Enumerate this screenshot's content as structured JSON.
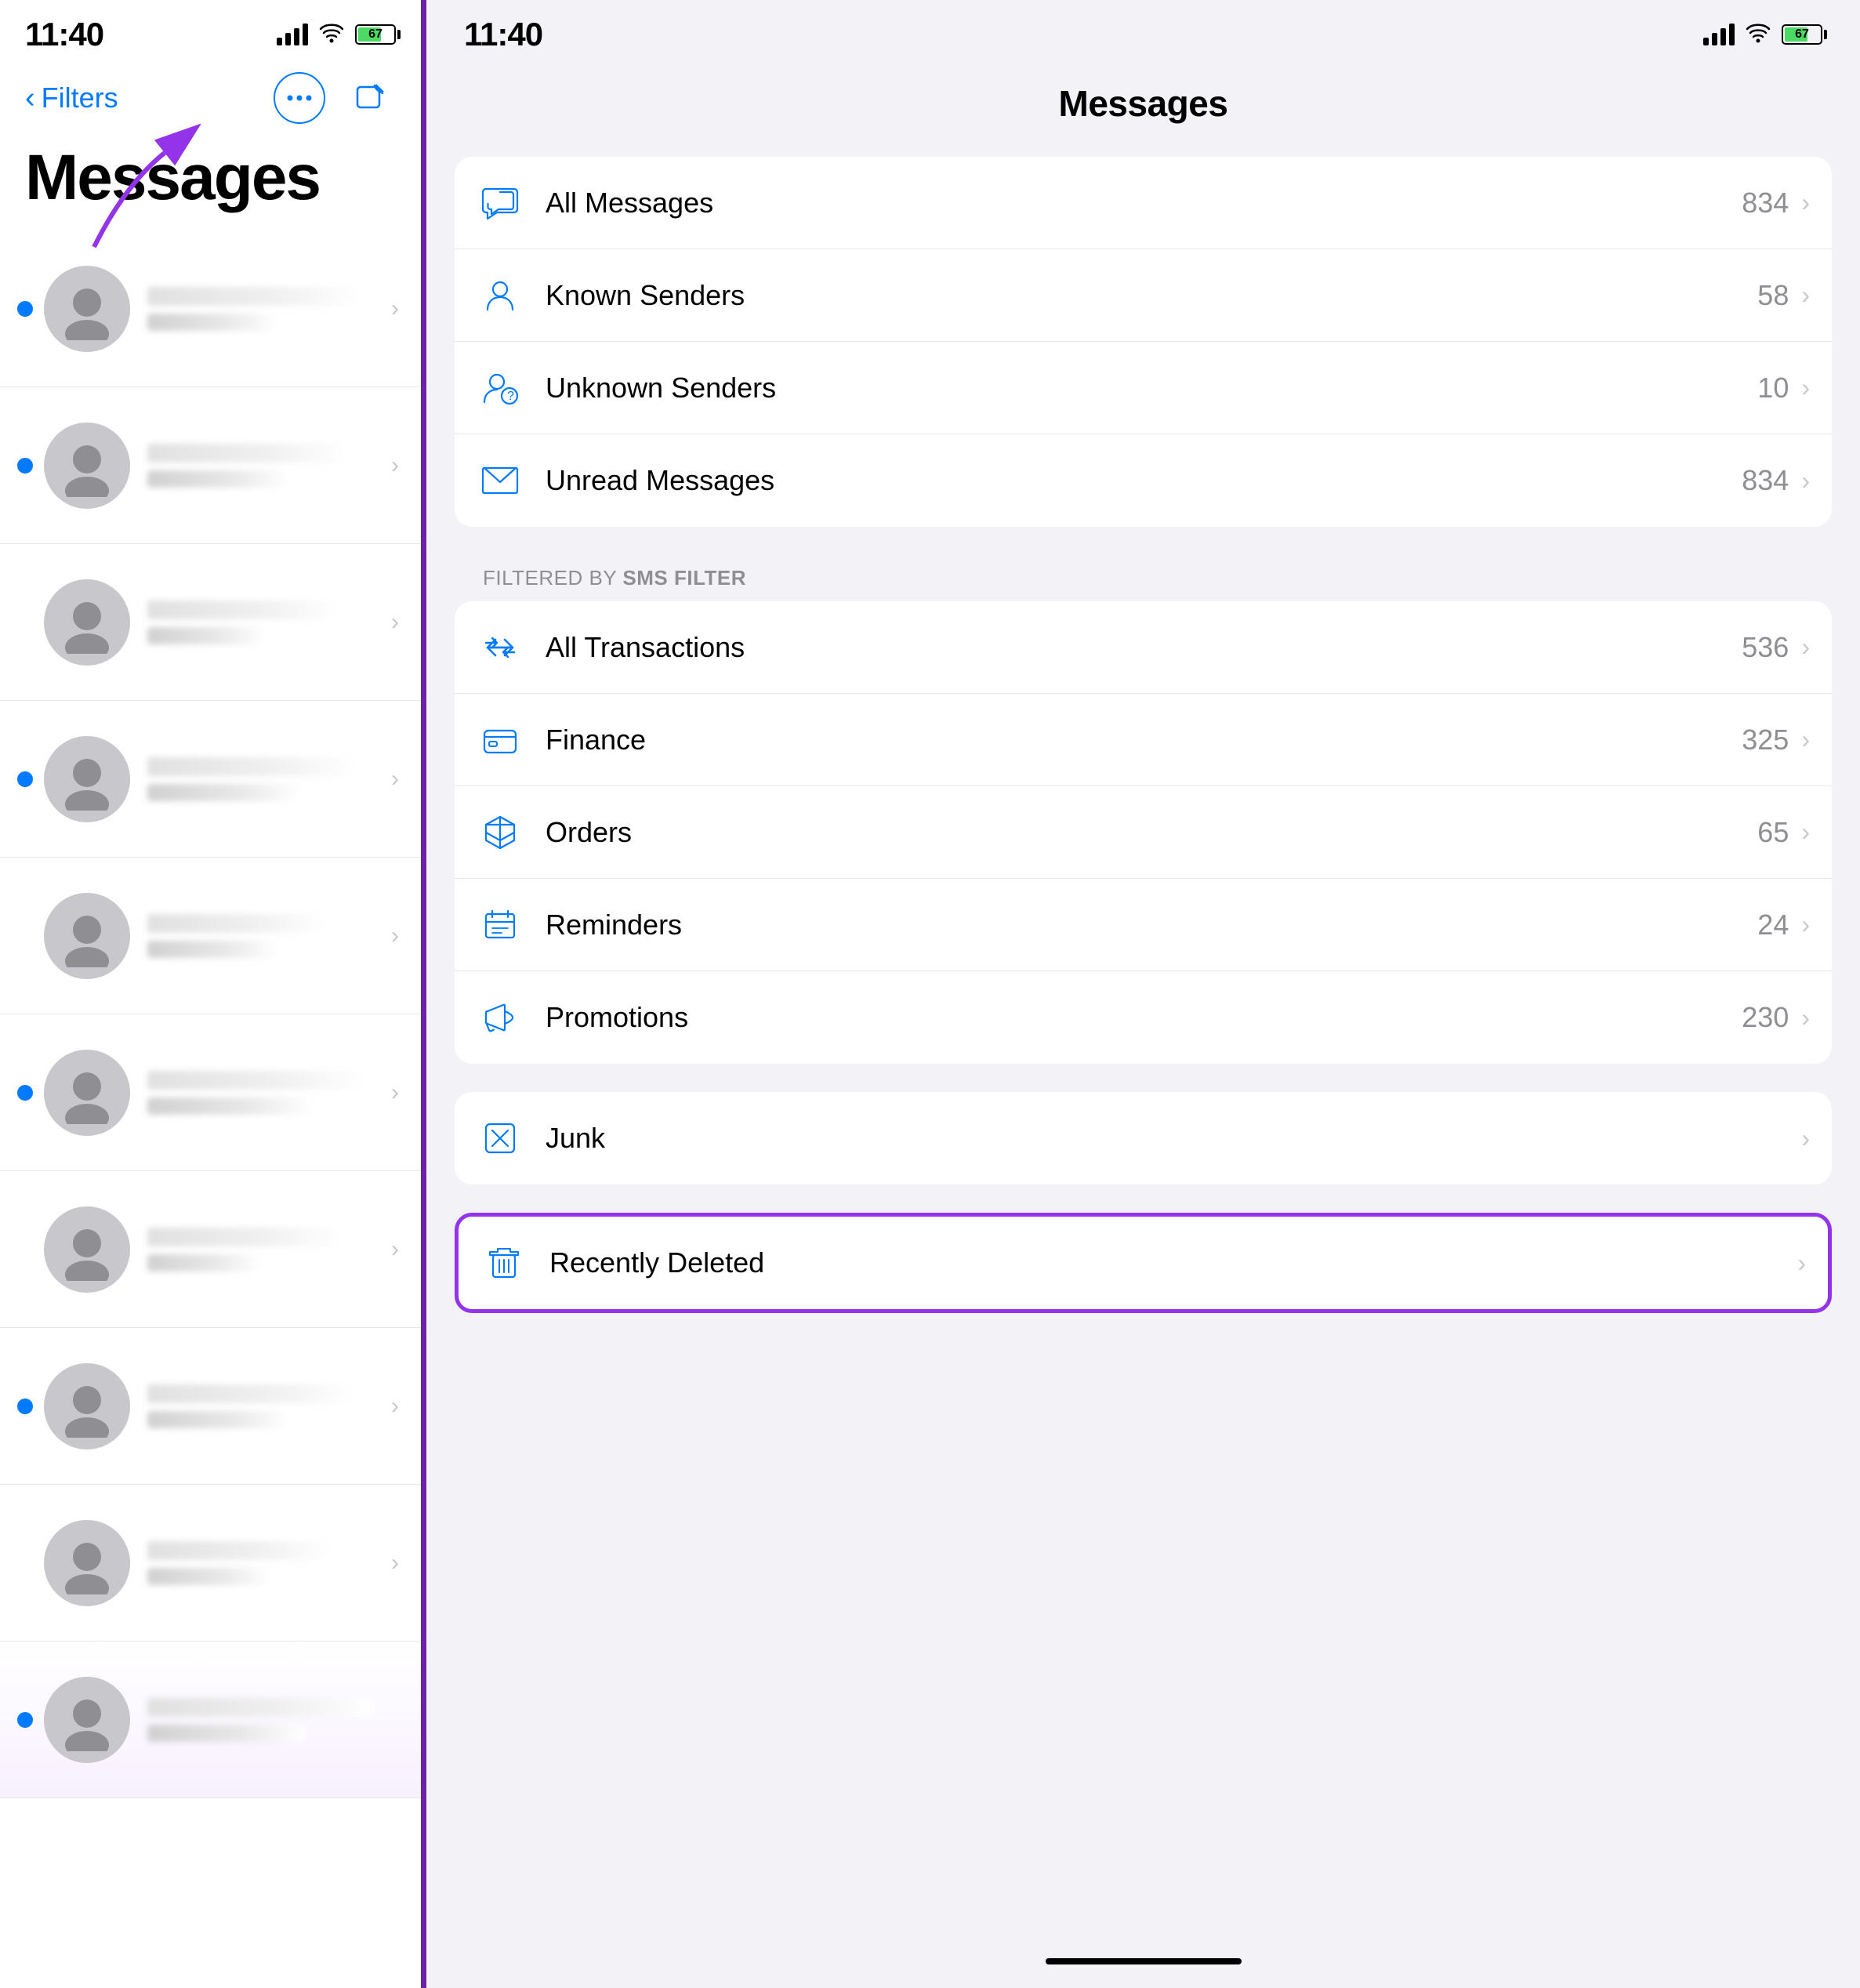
{
  "left": {
    "status": {
      "time": "11:40",
      "battery": "67"
    },
    "header": {
      "back_label": "Filters",
      "title": "Messages"
    },
    "list_items": [
      {
        "unread": true
      },
      {
        "unread": true
      },
      {
        "unread": false
      },
      {
        "unread": true
      },
      {
        "unread": false
      },
      {
        "unread": true
      },
      {
        "unread": false
      },
      {
        "unread": true
      },
      {
        "unread": false
      },
      {
        "unread": true
      }
    ]
  },
  "right": {
    "status": {
      "time": "11:40",
      "battery": "67"
    },
    "title": "Messages",
    "filter_section_label": "FILTERED BY ",
    "filter_section_bold": "SMS FILTER",
    "groups": {
      "top": [
        {
          "icon": "all-messages-icon",
          "label": "All Messages",
          "count": "834"
        },
        {
          "icon": "known-senders-icon",
          "label": "Known Senders",
          "count": "58"
        },
        {
          "icon": "unknown-senders-icon",
          "label": "Unknown Senders",
          "count": "10"
        },
        {
          "icon": "unread-messages-icon",
          "label": "Unread Messages",
          "count": "834"
        }
      ],
      "filtered": [
        {
          "icon": "all-transactions-icon",
          "label": "All Transactions",
          "count": "536"
        },
        {
          "icon": "finance-icon",
          "label": "Finance",
          "count": "325"
        },
        {
          "icon": "orders-icon",
          "label": "Orders",
          "count": "65"
        },
        {
          "icon": "reminders-icon",
          "label": "Reminders",
          "count": "24"
        },
        {
          "icon": "promotions-icon",
          "label": "Promotions",
          "count": "230"
        }
      ],
      "junk": [
        {
          "icon": "junk-icon",
          "label": "Junk",
          "count": ""
        }
      ],
      "recently_deleted": [
        {
          "icon": "recently-deleted-icon",
          "label": "Recently Deleted",
          "count": ""
        }
      ]
    }
  }
}
